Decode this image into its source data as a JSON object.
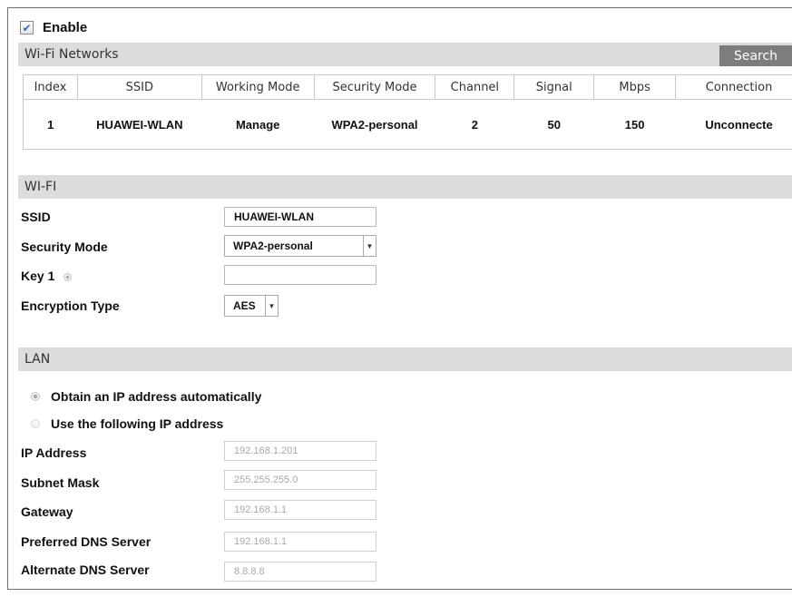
{
  "enable": {
    "label": "Enable",
    "checked": true
  },
  "wifi_networks": {
    "title": "Wi-Fi Networks",
    "search_label": "Search",
    "columns": [
      "Index",
      "SSID",
      "Working Mode",
      "Security Mode",
      "Channel",
      "Signal",
      "Mbps",
      "Connection"
    ],
    "rows": [
      [
        "1",
        "HUAWEI-WLAN",
        "Manage",
        "WPA2-personal",
        "2",
        "50",
        "150",
        "Unconnecte"
      ]
    ]
  },
  "wifi": {
    "title": "WI-FI",
    "ssid_label": "SSID",
    "ssid_value": "HUAWEI-WLAN",
    "security_mode_label": "Security Mode",
    "security_mode_value": "WPA2-personal",
    "key1_label": "Key 1",
    "key1_value": "",
    "encryption_type_label": "Encryption Type",
    "encryption_type_value": "AES"
  },
  "lan": {
    "title": "LAN",
    "obtain_auto_label": "Obtain an IP address automatically",
    "use_following_label": "Use the following IP address",
    "selected": "obtain_auto",
    "ip_address_label": "IP Address",
    "ip_address_value": "192.168.1.201",
    "subnet_mask_label": "Subnet Mask",
    "subnet_mask_value": "255.255.255.0",
    "gateway_label": "Gateway",
    "gateway_value": "192.168.1.1",
    "preferred_dns_label": "Preferred DNS Server",
    "preferred_dns_value": "192.168.1.1",
    "alternate_dns_label": "Alternate DNS Server",
    "alternate_dns_value": "8.8.8.8"
  },
  "icons": {
    "checkbox": "checkmark-icon",
    "dropdown": "chevron-down-icon",
    "radio": "radio-dot-icon",
    "info": "info-dot-icon"
  },
  "colors": {
    "section_bar": "#dcdcdc",
    "search_button": "#7d7d7d",
    "border": "#c8c8c8"
  }
}
